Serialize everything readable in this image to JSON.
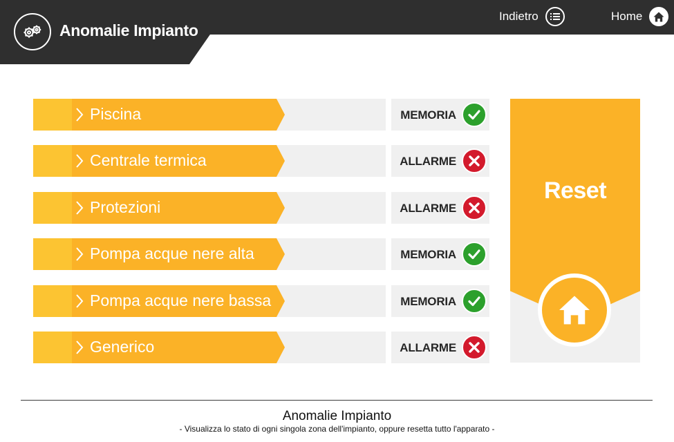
{
  "header": {
    "title": "Anomalie Impianto",
    "logo_icon": "gears-icon",
    "back_label": "Indietro",
    "back_icon": "list-icon",
    "home_label": "Home",
    "home_icon": "home-icon"
  },
  "zones": [
    {
      "label": "Piscina",
      "status": "MEMORIA",
      "status_icon": "check-icon",
      "state": "ok"
    },
    {
      "label": "Centrale termica",
      "status": "ALLARME",
      "status_icon": "cross-icon",
      "state": "err"
    },
    {
      "label": "Protezioni",
      "status": "ALLARME",
      "status_icon": "cross-icon",
      "state": "err"
    },
    {
      "label": "Pompa acque nere alta",
      "status": "MEMORIA",
      "status_icon": "check-icon",
      "state": "ok"
    },
    {
      "label": "Pompa acque nere bassa",
      "status": "MEMORIA",
      "status_icon": "check-icon",
      "state": "ok"
    },
    {
      "label": "Generico",
      "status": "ALLARME",
      "status_icon": "cross-icon",
      "state": "err"
    }
  ],
  "reset": {
    "label": "Reset",
    "icon": "home-icon"
  },
  "footer": {
    "title": "Anomalie Impianto",
    "subtitle": "- Visualizza lo stato di ogni singola zona dell'impianto, oppure resetta tutto l'apparato -"
  },
  "colors": {
    "header_bg": "#2f2f2f",
    "accent": "#fbb227",
    "accent_light": "#fcc432",
    "ok": "#2ca02c",
    "alarm": "#d31a2c",
    "track": "#f0f0f0"
  }
}
